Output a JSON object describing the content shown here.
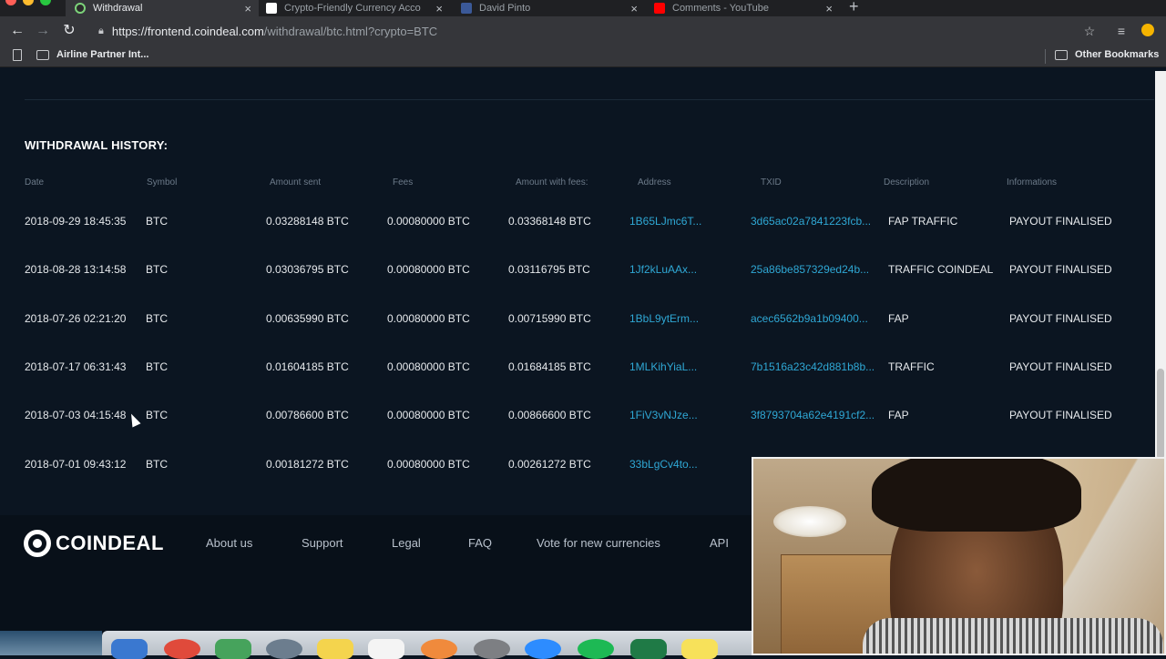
{
  "browser": {
    "tabs": [
      {
        "title": "Withdrawal",
        "active": true,
        "favicon_color": "#2b2b2b"
      },
      {
        "title": "Crypto-Friendly Currency Acco",
        "active": false,
        "favicon_color": "#ffffff"
      },
      {
        "title": "David Pinto",
        "active": false,
        "favicon_color": "#3b5998"
      },
      {
        "title": "Comments - YouTube",
        "active": false,
        "favicon_color": "#ff0000"
      }
    ],
    "url_host": "https://frontend.coindeal.com",
    "url_path": "/withdrawal/btc.html?crypto=BTC",
    "bookmarks": {
      "left": "Airline Partner Int...",
      "right": "Other Bookmarks"
    }
  },
  "history": {
    "title": "WITHDRAWAL HISTORY:",
    "columns": [
      "Date",
      "Symbol",
      "Amount sent",
      "Fees",
      "Amount with fees:",
      "Address",
      "TXID",
      "Description",
      "Informations"
    ],
    "rows": [
      {
        "date": "2018-09-29 18:45:35",
        "symbol": "BTC",
        "amount_sent": "0.03288148 BTC",
        "fees": "0.00080000 BTC",
        "amount_with_fees": "0.03368148 BTC",
        "address": "1B65LJmc6T...",
        "txid": "3d65ac02a7841223fcb...",
        "description": "FAP TRAFFIC",
        "info": "PAYOUT FINALISED"
      },
      {
        "date": "2018-08-28 13:14:58",
        "symbol": "BTC",
        "amount_sent": "0.03036795 BTC",
        "fees": "0.00080000 BTC",
        "amount_with_fees": "0.03116795 BTC",
        "address": "1Jf2kLuAAx...",
        "txid": "25a86be857329ed24b...",
        "description": "TRAFFIC COINDEAL",
        "info": "PAYOUT FINALISED"
      },
      {
        "date": "2018-07-26 02:21:20",
        "symbol": "BTC",
        "amount_sent": "0.00635990 BTC",
        "fees": "0.00080000 BTC",
        "amount_with_fees": "0.00715990 BTC",
        "address": "1BbL9ytErm...",
        "txid": "acec6562b9a1b09400...",
        "description": "FAP",
        "info": "PAYOUT FINALISED"
      },
      {
        "date": "2018-07-17 06:31:43",
        "symbol": "BTC",
        "amount_sent": "0.01604185 BTC",
        "fees": "0.00080000 BTC",
        "amount_with_fees": "0.01684185 BTC",
        "address": "1MLKihYiaL...",
        "txid": "7b1516a23c42d881b8b...",
        "description": "TRAFFIC",
        "info": "PAYOUT FINALISED"
      },
      {
        "date": "2018-07-03 04:15:48",
        "symbol": "BTC",
        "amount_sent": "0.00786600 BTC",
        "fees": "0.00080000 BTC",
        "amount_with_fees": "0.00866600 BTC",
        "address": "1FiV3vNJze...",
        "txid": "3f8793704a62e4191cf2...",
        "description": "FAP",
        "info": "PAYOUT FINALISED"
      },
      {
        "date": "2018-07-01 09:43:12",
        "symbol": "BTC",
        "amount_sent": "0.00181272 BTC",
        "fees": "0.00080000 BTC",
        "amount_with_fees": "0.00261272 BTC",
        "address": "33bLgCv4to...",
        "txid": "",
        "description": "",
        "info": ""
      }
    ]
  },
  "footer": {
    "logo_text": "COINDEAL",
    "links": [
      "About us",
      "Support",
      "Legal",
      "FAQ",
      "Vote for new currencies",
      "API"
    ]
  },
  "colors": {
    "page_bg": "#0b1521",
    "link": "#2fa8d5",
    "text": "#e6e9ec",
    "header_text": "#6c7a89"
  }
}
